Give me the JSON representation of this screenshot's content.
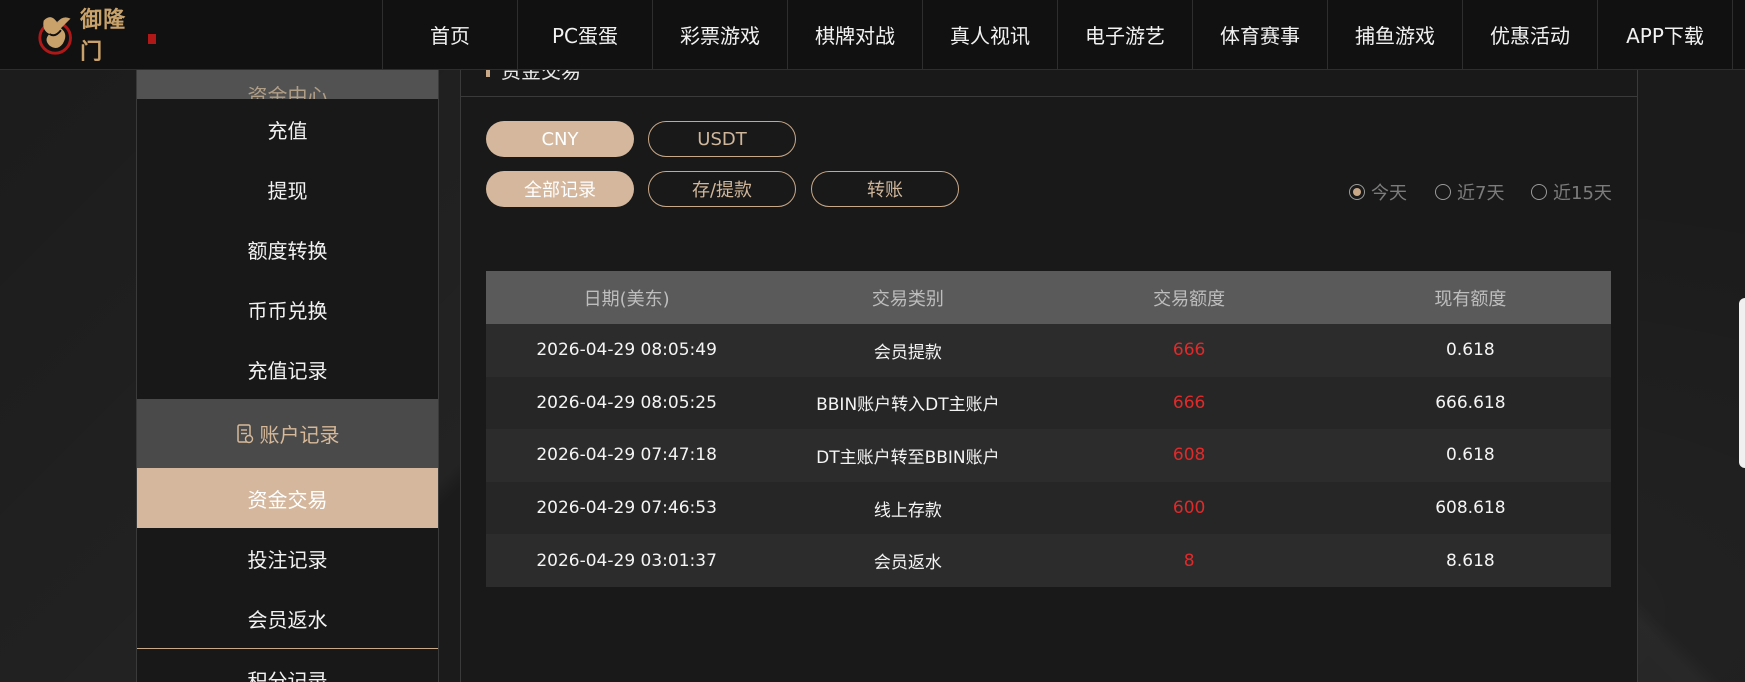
{
  "brand": {
    "name": "御隆门",
    "colors": {
      "accent": "#d4b79c",
      "nav_bg": "#111111",
      "amount_red": "#e02a2a"
    }
  },
  "nav": {
    "items": [
      "首页",
      "PC蛋蛋",
      "彩票游戏",
      "棋牌对战",
      "真人视讯",
      "电子游艺",
      "体育赛事",
      "捕鱼游戏",
      "优惠活动",
      "APP下载"
    ]
  },
  "sidebar": {
    "group_top_label": "资金中心",
    "items_top": [
      "充值",
      "提现",
      "额度转换",
      "币币兑换",
      "充值记录"
    ],
    "group_header": {
      "icon": "document-icon",
      "label": "账户记录"
    },
    "items_bottom": [
      "资金交易",
      "投注记录",
      "会员返水",
      "积分记录"
    ],
    "active_item": "资金交易"
  },
  "main": {
    "title": "资金交易",
    "currency_tabs": [
      "CNY",
      "USDT"
    ],
    "active_currency": "CNY",
    "type_tabs": [
      "全部记录",
      "存/提款",
      "转账"
    ],
    "active_type": "全部记录",
    "date_ranges": [
      "今天",
      "近7天",
      "近15天"
    ],
    "active_range": "今天",
    "table": {
      "headers": [
        "日期(美东)",
        "交易类别",
        "交易额度",
        "现有额度"
      ],
      "rows": [
        [
          "2026-04-29 08:05:49",
          "会员提款",
          "666",
          "0.618"
        ],
        [
          "2026-04-29 08:05:25",
          "BBIN账户转入DT主账户",
          "666",
          "666.618"
        ],
        [
          "2026-04-29 07:47:18",
          "DT主账户转至BBIN账户",
          "608",
          "0.618"
        ],
        [
          "2026-04-29 07:46:53",
          "线上存款",
          "600",
          "608.618"
        ],
        [
          "2026-04-29 03:01:37",
          "会员返水",
          "8",
          "8.618"
        ]
      ]
    }
  }
}
